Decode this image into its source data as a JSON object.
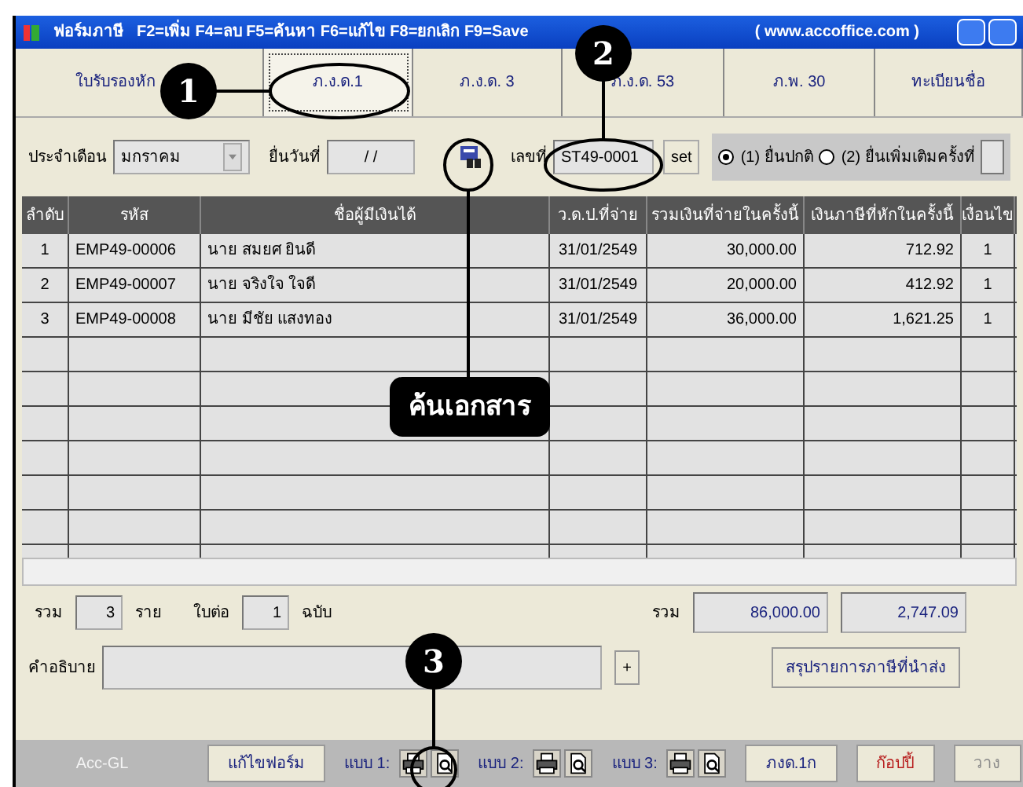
{
  "window": {
    "title": "ฟอร์มภาษี",
    "hotkeys": "F2=เพิ่ม F4=ลบ F5=ค้นหา F6=แก้ไข F8=ยกเลิก F9=Save",
    "website": "( www.accoffice.com )"
  },
  "tabs": [
    {
      "label": "ใบรับรองหัก",
      "selected": false
    },
    {
      "label": "ภ.ง.ด.1",
      "selected": true
    },
    {
      "label": "ภ.ง.ด. 3",
      "selected": false
    },
    {
      "label": "ภ.ง.ด. 53",
      "selected": false
    },
    {
      "label": "ภ.พ. 30",
      "selected": false
    },
    {
      "label": "ทะเบียนชื่อ",
      "selected": false
    }
  ],
  "form": {
    "month_label": "ประจำเดือน",
    "month": "มกราคม",
    "date_label": "ยื่นวันที่",
    "date": "/ /",
    "number_label": "เลขที่",
    "number": "ST49-0001",
    "set_button": "set",
    "filing": [
      {
        "label": "(1) ยื่นปกติ",
        "selected": true
      },
      {
        "label": "(2) ยื่นเพิ่มเติมครั้งที่",
        "selected": false
      }
    ]
  },
  "table": {
    "columns": [
      "ลำดับ",
      "รหัส",
      "ชื่อผู้มีเงินได้",
      "ว.ด.ป.ที่จ่าย",
      "รวมเงินที่จ่ายในครั้งนี้",
      "เงินภาษีที่หักในครั้งนี้",
      "เงื่อนไข"
    ],
    "rows": [
      [
        "1",
        "EMP49-00006",
        "นาย  สมยศ ยินดี",
        "31/01/2549",
        "30,000.00",
        "712.92",
        "1"
      ],
      [
        "2",
        "EMP49-00007",
        "นาย  จริงใจ ใจดี",
        "31/01/2549",
        "20,000.00",
        "412.92",
        "1"
      ],
      [
        "3",
        "EMP49-00008",
        "นาย  มีชัย แสงทอง",
        "31/01/2549",
        "36,000.00",
        "1,621.25",
        "1"
      ]
    ]
  },
  "totals": {
    "total_label": "รวม",
    "count": "3",
    "count_unit": "ราย",
    "sheets_label": "ใบต่อ",
    "sheets": "1",
    "sheets_unit": "ฉบับ",
    "sum_label": "รวม",
    "sum_paid": "86,000.00",
    "sum_tax": "2,747.09"
  },
  "description": {
    "label": "คำอธิบาย",
    "plus_button": "+",
    "summary_button": "สรุปรายการภาษีที่นำส่ง"
  },
  "toolbar": [
    {
      "kind": "label",
      "text": "Acc-GL",
      "disabled": true
    },
    {
      "kind": "button",
      "text": "แก้ไขฟอร์ม",
      "disabled": false
    },
    {
      "kind": "print",
      "text": "แบบ 1:"
    },
    {
      "kind": "print",
      "text": "แบบ 2:"
    },
    {
      "kind": "print",
      "text": "แบบ 3:"
    },
    {
      "kind": "button",
      "text": "ภงด.1ก",
      "disabled": false
    },
    {
      "kind": "copy",
      "text": "ก๊อปปี้",
      "disabled": false
    },
    {
      "kind": "button",
      "text": "วาง",
      "disabled": true
    }
  ],
  "callouts": [
    "1",
    "2",
    "3"
  ],
  "search_caption": "ค้นเอกสาร"
}
